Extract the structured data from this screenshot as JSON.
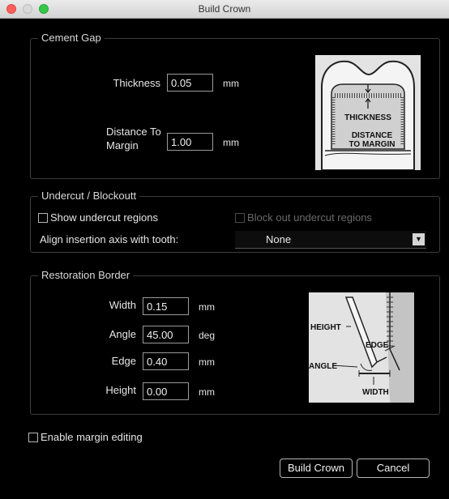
{
  "window": {
    "title": "Build Crown"
  },
  "cement_gap": {
    "legend": "Cement Gap",
    "thickness_label": "Thickness",
    "thickness_value": "0.05",
    "thickness_unit": "mm",
    "distance_label_line1": "Distance To",
    "distance_label_line2": "Margin",
    "distance_value": "1.00",
    "distance_unit": "mm",
    "diagram": {
      "thickness": "THICKNESS",
      "distance_line1": "DISTANCE",
      "distance_line2": "TO MARGIN"
    }
  },
  "undercut": {
    "legend": "Undercut / Blockoutt",
    "show_regions": "Show undercut regions",
    "block_out": "Block out undercut regions",
    "align_label": "Align insertion axis with tooth:",
    "align_value": "None"
  },
  "restoration": {
    "legend": "Restoration Border",
    "width_label": "Width",
    "width_value": "0.15",
    "width_unit": "mm",
    "angle_label": "Angle",
    "angle_value": "45.00",
    "angle_unit": "deg",
    "edge_label": "Edge",
    "edge_value": "0.40",
    "edge_unit": "mm",
    "height_label": "Height",
    "height_value": "0.00",
    "height_unit": "mm",
    "diagram": {
      "height": "HEIGHT",
      "edge": "EDGE",
      "angle": "ANGLE",
      "width": "WIDTH"
    }
  },
  "margin_editing": {
    "label": "Enable margin editing"
  },
  "buttons": {
    "build": "Build Crown",
    "cancel": "Cancel"
  },
  "icons": {
    "close": "close-icon",
    "minimize": "minimize-icon",
    "zoom": "zoom-icon",
    "dropdown": "chevron-down-icon"
  }
}
